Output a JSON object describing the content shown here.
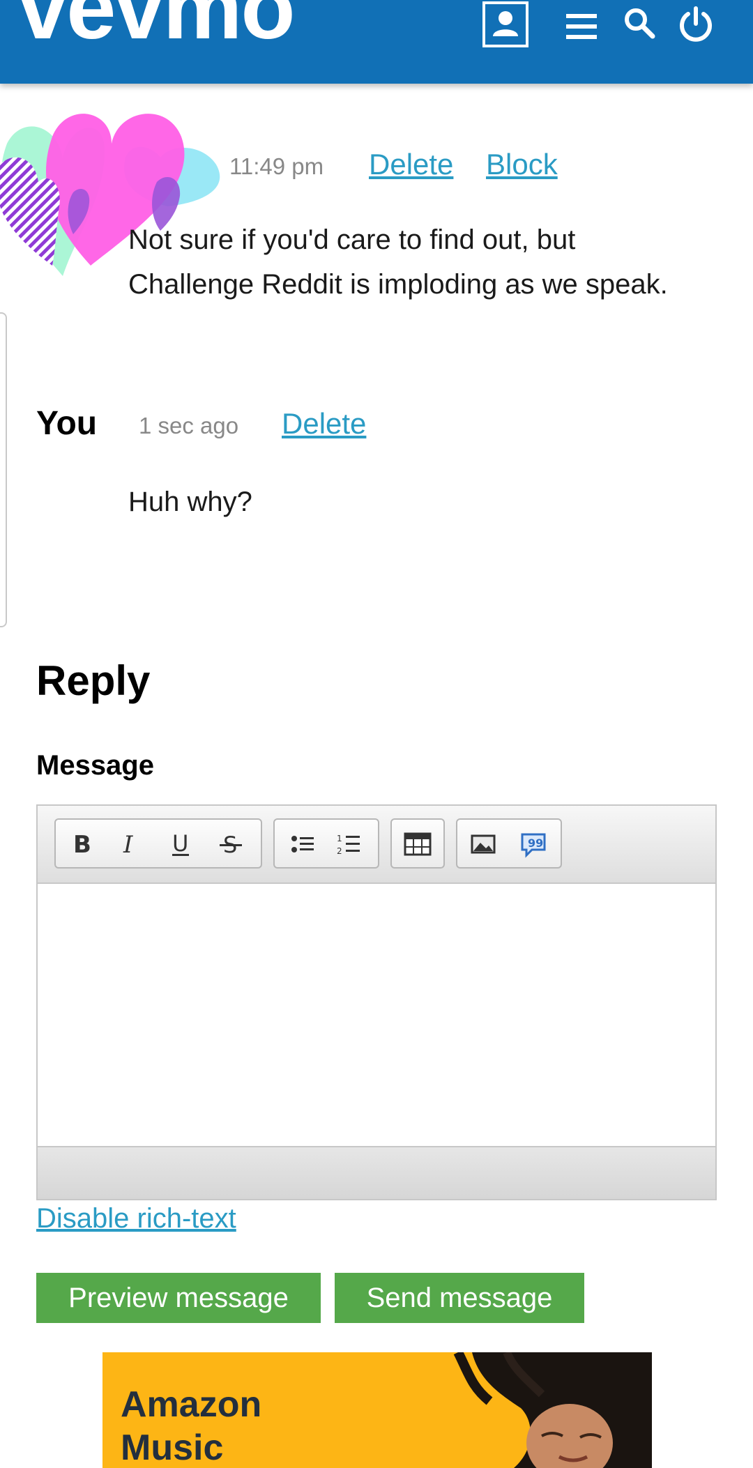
{
  "header": {
    "logo": "vevmo",
    "background_color": "#1170b6",
    "icons": [
      "profile-icon",
      "menu-icon",
      "search-icon",
      "power-icon"
    ]
  },
  "messages": [
    {
      "sender": "",
      "time": "11:49 pm",
      "actions": [
        "Delete",
        "Block"
      ],
      "text_lines": [
        "Not sure if you'd care to find out, but",
        "Challenge Reddit is imploding as we speak."
      ]
    },
    {
      "sender": "You",
      "time": "1 sec ago",
      "actions": [
        "Delete"
      ],
      "text_lines": [
        "Huh why?"
      ]
    }
  ],
  "reply": {
    "title": "Reply",
    "field_label": "Message",
    "editor_value": "",
    "toolbar": [
      "bold-icon",
      "italic-icon",
      "underline-icon",
      "strikethrough-icon",
      "bullet-list-icon",
      "numbered-list-icon",
      "table-icon",
      "image-icon",
      "quote-icon"
    ],
    "disable_link": "Disable rich-text",
    "preview_button": "Preview message",
    "send_button": "Send message",
    "button_color": "#55a84a",
    "link_color": "#2a9bc4"
  },
  "ad": {
    "text": "Amazon\nMusic",
    "background_color": "#fdb515"
  }
}
